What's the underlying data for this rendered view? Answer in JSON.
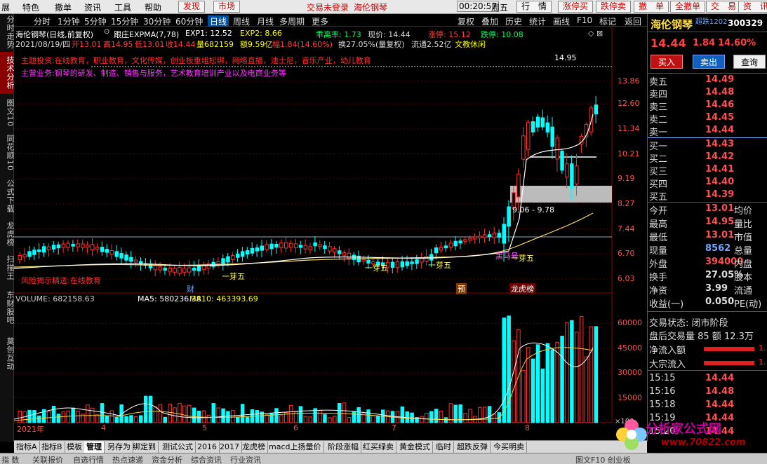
{
  "menubar": {
    "items": [
      "展",
      "特色",
      "撤单",
      "资讯",
      "工具",
      "帮助"
    ],
    "find": "发现",
    "market": "市场",
    "login_notice": "交易未登录",
    "login_stock": "海伦钢琴",
    "time": "00:20:57",
    "weekday": "周五",
    "buttons": [
      "行　情",
      "涨停买",
      "跌停卖",
      "撤　单",
      "全撤单",
      "交　易",
      "资　讯"
    ]
  },
  "vtabs": [
    "分时走势",
    "技术分析",
    "图文10",
    "同花顺10",
    "公式下载",
    "龙虎榜",
    "扫描王",
    "东财股吧",
    "莫创互动"
  ],
  "periodbar": {
    "items": [
      "分时",
      "1分钟",
      "5分钟",
      "15分钟",
      "30分钟",
      "60分钟",
      "日线",
      "周线",
      "月线",
      "多周期",
      "更多"
    ],
    "active": "日线",
    "tools": [
      "复权",
      "叠加",
      "历史",
      "统计",
      "画线",
      "F10",
      "标记",
      "返回"
    ]
  },
  "chart": {
    "title": "海伦钢琴(日线,前复权)",
    "indicator_name": "跟庄EXPMA(7,78)",
    "exp1_label": "EXP1: 12.52",
    "exp2_label": "EXP2: 8.66",
    "deviation_label": "乖离率: 1.73",
    "price_label": "现价: 14.44",
    "limit_up": "涨停: 15.12",
    "limit_down": "跌停: 10.08",
    "date": "2021/08/19/四",
    "open_label": "开13.01",
    "high_label": "高14.95",
    "low_label": "低13.01",
    "close_label": "收14.44",
    "vol_label": "量682159",
    "amt_label": "额9.59亿",
    "range_label": "幅1.84(14.60%)",
    "turnover_label": "换27.05%(量复权)",
    "float_label": "流通2.52亿",
    "sector": "文教休闲",
    "topic_line": "主题投资:在线教育，职业教育，文化传媒，创业板重组松绑，网络直播，迪士尼，音乐产业，幼儿教育",
    "business_line": "主营业务:钢琴的研发、制造、销售与服务，艺术教育培训产业以及电商业务等",
    "bottom_note": "风险揭示精选:在线教育",
    "max_label": "14.95",
    "range_note": "9.06 - 9.78",
    "tag_heiwu": "黑马号",
    "tag_yiya": "一芽五",
    "tag_cai": "财",
    "tag_yu": "预",
    "tag_longhu": "龙虎榜",
    "y_axis": [
      "13.86",
      "12.60",
      "11.34",
      "10.21",
      "9.19",
      "8.27",
      "7.44",
      "6.70",
      "6.03"
    ],
    "x_axis": [
      "2021年",
      "4",
      "5",
      "6",
      "7",
      "8"
    ],
    "vol_title": "VOLUME: 682158.63",
    "ma5_label": "MA5: 580236.38",
    "ma10_label": "MA10: 463393.69",
    "vol_axis": [
      "60000",
      "45000",
      "30000",
      "15000"
    ],
    "vol_unit": "×100"
  },
  "chart_data": {
    "type": "candlestick",
    "x": [
      "2021-01",
      "2021-04",
      "2021-05",
      "2021-06",
      "2021-07",
      "2021-08"
    ],
    "price_ticks": [
      13.86,
      12.6,
      11.34,
      10.21,
      9.19,
      8.27,
      7.44,
      6.7,
      6.03
    ],
    "volume_ticks": [
      60000,
      45000,
      30000,
      15000
    ],
    "last": {
      "date": "2021/08/19",
      "open": 13.01,
      "high": 14.95,
      "low": 13.01,
      "close": 14.44,
      "volume": 682159
    },
    "indicators": {
      "EXP1": 12.52,
      "EXP2": 8.66,
      "乖离率": 1.73,
      "MA5": 580236.38,
      "MA10": 463393.69,
      "VOLUME": 682158.63
    }
  },
  "quote": {
    "name": "海伦钢琴",
    "code": "300329",
    "flag": "超跌1202",
    "price": "14.44",
    "change": "1.84",
    "pct": "14.60%",
    "btn_buy": "买入",
    "btn_sell": "卖出",
    "btn_query": "查询",
    "asks": [
      {
        "n": "卖五",
        "p": "14.49",
        "v": ""
      },
      {
        "n": "卖四",
        "p": "14.48",
        "v": ""
      },
      {
        "n": "卖三",
        "p": "14.46",
        "v": ""
      },
      {
        "n": "卖二",
        "p": "14.45",
        "v": ""
      },
      {
        "n": "卖一",
        "p": "14.44",
        "v": ""
      }
    ],
    "bids": [
      {
        "n": "买一",
        "p": "14.43",
        "v": ""
      },
      {
        "n": "买二",
        "p": "14.42",
        "v": ""
      },
      {
        "n": "买三",
        "p": "14.41",
        "v": ""
      },
      {
        "n": "买四",
        "p": "14.40",
        "v": ""
      },
      {
        "n": "买五",
        "p": "14.39",
        "v": ""
      }
    ],
    "fund": [
      {
        "l1": "今开",
        "v1": "13.01",
        "c": "#ff5050",
        "l2": "均价"
      },
      {
        "l1": "最高",
        "v1": "14.95",
        "c": "#ff5050",
        "l2": "量比"
      },
      {
        "l1": "最低",
        "v1": "13.01",
        "c": "#ff5050",
        "l2": "市值"
      },
      {
        "l1": "现量",
        "v1": "8562",
        "c": "#6fa8ff",
        "l2": "总量"
      },
      {
        "l1": "外盘",
        "v1": "394000",
        "c": "#ff5050",
        "l2": "内盘"
      },
      {
        "l1": "换手",
        "v1": "27.05%",
        "c": "#ddd",
        "l2": "股本"
      },
      {
        "l1": "净资",
        "v1": "3.99",
        "c": "#ddd",
        "l2": "流通"
      },
      {
        "l1": "收益(一)",
        "v1": "0.050",
        "c": "#ddd",
        "l2": "PE(动)"
      }
    ],
    "trade_status": "交易状态: 闭市阶段",
    "after_hours": "盘后交易量 85 额 12.3万",
    "net_inflow": "净流入额",
    "block_inflow": "大宗流入",
    "ticks": [
      {
        "t": "15:15",
        "p": "14.44"
      },
      {
        "t": "15:16",
        "p": "14.48"
      },
      {
        "t": "15:18",
        "p": "14.44"
      },
      {
        "t": "15:19",
        "p": "14.44"
      },
      {
        "t": "15:20",
        "p": "14.44"
      }
    ]
  },
  "bottombar": [
    "指标A",
    "指标B",
    "模板",
    "管理",
    "另存为",
    "绑定到",
    "测试公式",
    "2016",
    "2017",
    "龙虎榜",
    "macd上扬量价",
    "阶段涨幅",
    "红买绿卖",
    "黄金模式",
    "临时",
    "超跌反弹",
    "今买明卖"
  ],
  "bottombar_active": "管理",
  "statusbar": [
    "指 数",
    "关联报价",
    "自选行情",
    "热点速递",
    "资金分析",
    "综合资讯",
    "行业资讯",
    "图文F10 创业板"
  ],
  "logo": {
    "text": "分析家公式网",
    "url": "www.70822.com"
  },
  "colors": {
    "up": "#ff3030",
    "down": "#00ffff",
    "exp1": "#ffffff",
    "exp2": "#ffff00",
    "accent": "#c00000"
  }
}
